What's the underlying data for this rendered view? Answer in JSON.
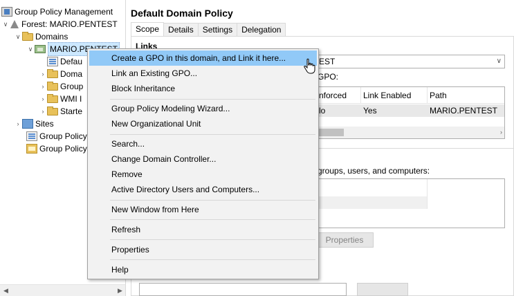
{
  "tree": {
    "root_label": "Group Policy Management",
    "forest_label": "Forest: MARIO.PENTEST",
    "domains_label": "Domains",
    "domain_label": "MARIO.PENTEST",
    "child_items": [
      "Defau",
      "Doma",
      "Group",
      "WMI I",
      "Starte"
    ],
    "sites_label": "Sites",
    "gp_items": [
      "Group Policy",
      "Group Policy"
    ]
  },
  "details": {
    "title": "Default Domain Policy",
    "tabs": [
      "Scope",
      "Details",
      "Settings",
      "Delegation"
    ],
    "active_tab": "Scope",
    "links_heading": "Links",
    "combo_value_tail": "EST",
    "gpo_label_tail": "GPO:",
    "grid": {
      "columns": [
        "nforced",
        "Link Enabled",
        "Path"
      ],
      "row": [
        "lo",
        "Yes",
        "MARIO.PENTEST"
      ]
    },
    "filter_label_tail": "groups, users, and computers:",
    "properties_button": "Properties"
  },
  "context_menu": {
    "groups": [
      [
        "Create a GPO in this domain, and Link it here...",
        "Link an Existing GPO...",
        "Block Inheritance"
      ],
      [
        "Group Policy Modeling Wizard...",
        "New Organizational Unit"
      ],
      [
        "Search...",
        "Change Domain Controller...",
        "Remove",
        "Active Directory Users and Computers..."
      ],
      [
        "New Window from Here"
      ],
      [
        "Refresh"
      ],
      [
        "Properties"
      ],
      [
        "Help"
      ]
    ],
    "highlighted": "Create a GPO in this domain, and Link it here..."
  },
  "colors": {
    "menu_highlight": "#91c9f7",
    "tree_selection": "#cce8ff",
    "menu_background": "#f2f2f2"
  }
}
